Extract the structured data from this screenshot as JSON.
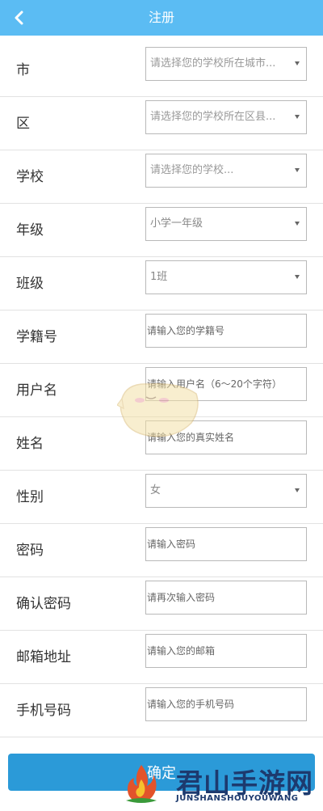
{
  "header": {
    "title": "注册"
  },
  "form": {
    "city": {
      "label": "市",
      "placeholder": "请选择您的学校所在城市..."
    },
    "district": {
      "label": "区",
      "placeholder": "请选择您的学校所在区县..."
    },
    "school": {
      "label": "学校",
      "placeholder": "请选择您的学校..."
    },
    "grade": {
      "label": "年级",
      "value": "小学一年级"
    },
    "class": {
      "label": "班级",
      "value": "1班"
    },
    "student_id": {
      "label": "学籍号",
      "placeholder": "请输入您的学籍号"
    },
    "username": {
      "label": "用户名",
      "placeholder": "请输入用户名（6～20个字符）"
    },
    "real_name": {
      "label": "姓名",
      "placeholder": "请输入您的真实姓名"
    },
    "gender": {
      "label": "性别",
      "value": "女"
    },
    "password": {
      "label": "密码",
      "placeholder": "请输入密码"
    },
    "confirm_password": {
      "label": "确认密码",
      "placeholder": "请再次输入密码"
    },
    "email": {
      "label": "邮箱地址",
      "placeholder": "请输入您的邮箱"
    },
    "phone": {
      "label": "手机号码",
      "placeholder": "请输入您的手机号码"
    }
  },
  "submit": {
    "label": "确定"
  },
  "watermark": {
    "name": "君山手游网",
    "sub": "JUNSHANSHOUYOUWANG"
  },
  "colors": {
    "header": "#5bbcf3",
    "button": "#2b9ad8"
  }
}
